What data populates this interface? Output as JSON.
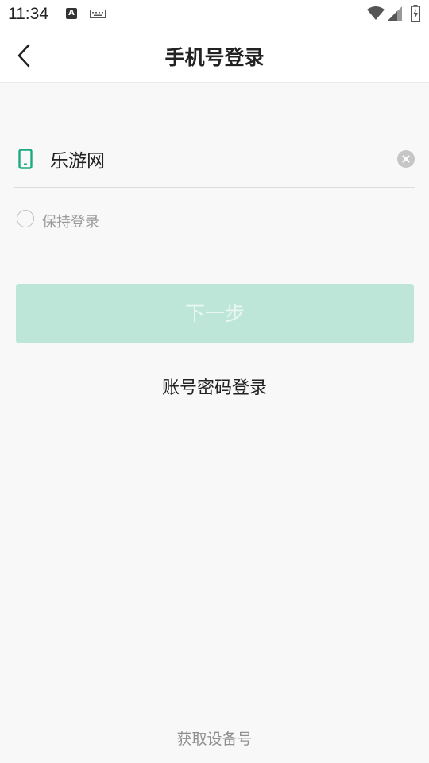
{
  "status_bar": {
    "time": "11:34",
    "icons": [
      "a-notification-icon",
      "keyboard-icon",
      "wifi-icon",
      "signal-icon",
      "battery-charging-icon"
    ]
  },
  "header": {
    "title": "手机号登录",
    "back_icon": "chevron-left-icon"
  },
  "login_form": {
    "phone_icon": "mobile-phone-icon",
    "phone_value": "乐游网",
    "clear_icon": "clear-circle-icon",
    "keep_login_label": "保持登录",
    "keep_login_checked": false,
    "next_button_label": "下一步",
    "next_button_enabled": false
  },
  "links": {
    "account_password_login": "账号密码登录",
    "get_device_id": "获取设备号"
  },
  "colors": {
    "accent": "#1aab7f",
    "button_disabled_bg": "#bde6d9",
    "background": "#f8f8f8"
  }
}
